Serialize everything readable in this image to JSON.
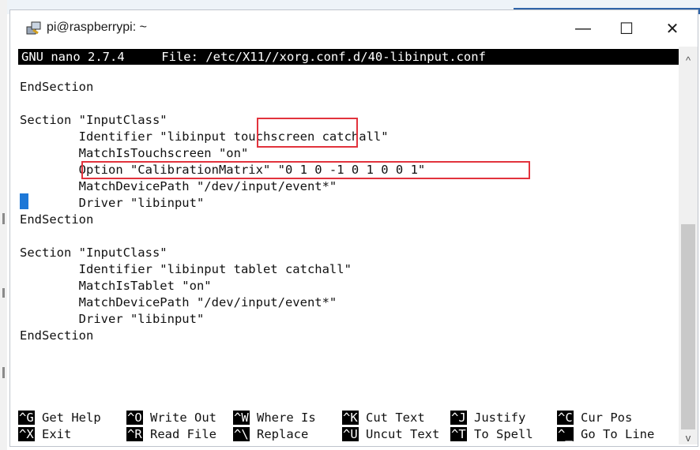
{
  "window": {
    "title": "pi@raspberrypi: ~",
    "minimize_glyph": "—",
    "maximize_glyph": "☐",
    "close_glyph": "✕"
  },
  "nano": {
    "header": "GNU nano 2.7.4     File: /etc/X11//xorg.conf.d/40-libinput.conf"
  },
  "lines": [
    "EndSection",
    "",
    "Section \"InputClass\"",
    "        Identifier \"libinput touchscreen catchall\"",
    "        MatchIsTouchscreen \"on\"",
    "        Option \"CalibrationMatrix\" \"0 1 0 -1 0 1 0 0 1\"",
    "        MatchDevicePath \"/dev/input/event*\"",
    "        Driver \"libinput\"",
    "EndSection",
    "",
    "Section \"InputClass\"",
    "        Identifier \"libinput tablet catchall\"",
    "        MatchIsTablet \"on\"",
    "        MatchDevicePath \"/dev/input/event*\"",
    "        Driver \"libinput\"",
    "EndSection"
  ],
  "shortcuts_row1": [
    {
      "key": "^G",
      "label": "Get Help"
    },
    {
      "key": "^O",
      "label": "Write Out"
    },
    {
      "key": "^W",
      "label": "Where Is"
    },
    {
      "key": "^K",
      "label": "Cut Text"
    },
    {
      "key": "^J",
      "label": "Justify"
    },
    {
      "key": "^C",
      "label": "Cur Pos"
    }
  ],
  "shortcuts_row2": [
    {
      "key": "^X",
      "label": "Exit"
    },
    {
      "key": "^R",
      "label": "Read File"
    },
    {
      "key": "^\\",
      "label": "Replace"
    },
    {
      "key": "^U",
      "label": "Uncut Text"
    },
    {
      "key": "^T",
      "label": "To Spell"
    },
    {
      "key": "^_",
      "label": "Go To Line"
    }
  ],
  "scrollbar": {
    "up_glyph": "^",
    "down_glyph": "v"
  },
  "colors": {
    "highlight": "#e2333d",
    "cursor": "#1e78d7",
    "terminal_bg": "#ffffff",
    "header_bg": "#000000"
  }
}
